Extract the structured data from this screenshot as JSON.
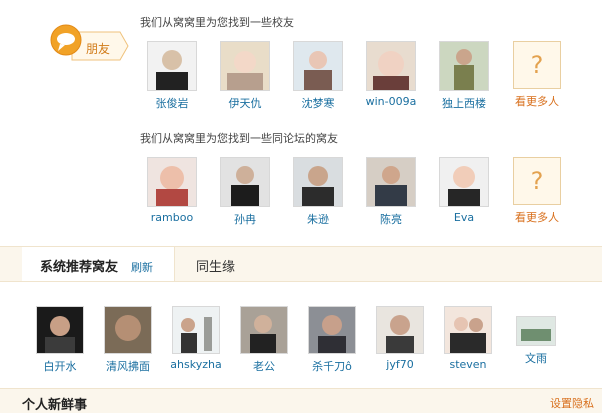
{
  "badge": {
    "label": "朋友"
  },
  "schoolmates": {
    "title": "我们从窝窝里为您找到一些校友",
    "people": [
      {
        "name": "张俊岩"
      },
      {
        "name": "伊天仇"
      },
      {
        "name": "沈梦寒"
      },
      {
        "name": "win-009a"
      },
      {
        "name": "独上西楼"
      }
    ],
    "more": {
      "symbol": "?",
      "label": "看更多人"
    }
  },
  "forum_friends": {
    "title": "我们从窝窝里为您找到一些同论坛的窝友",
    "people": [
      {
        "name": "ramboo"
      },
      {
        "name": "孙冉"
      },
      {
        "name": "朱逊"
      },
      {
        "name": "陈亮"
      },
      {
        "name": "Eva"
      }
    ],
    "more": {
      "symbol": "?",
      "label": "看更多人"
    }
  },
  "tabs": {
    "active": {
      "label": "系统推荐窝友",
      "refresh": "刷新"
    },
    "other": {
      "label": "同生缘"
    }
  },
  "recommended": [
    {
      "name": "白开水"
    },
    {
      "name": "清风拂面"
    },
    {
      "name": "ahskyzha"
    },
    {
      "name": "老公"
    },
    {
      "name": "杀千刀ô"
    },
    {
      "name": "jyf70"
    },
    {
      "name": "steven"
    },
    {
      "name": "文雨"
    }
  ],
  "footer": {
    "title": "个人新鲜事",
    "privacy": "设置隐私"
  },
  "colors": {
    "link": "#1a6fa0",
    "accent": "#d86f1c",
    "bar": "#fbf6ec"
  }
}
